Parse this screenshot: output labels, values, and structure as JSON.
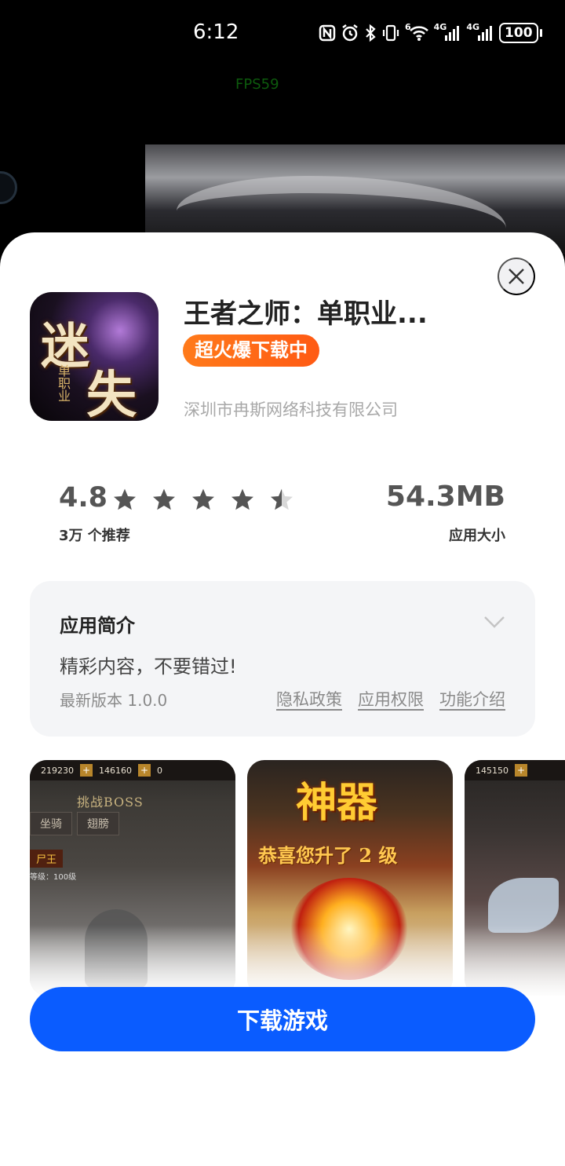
{
  "status_bar": {
    "time": "6:12",
    "net1": "4G",
    "net2": "4G",
    "wifi_tag": "6",
    "battery": "100"
  },
  "overlay": {
    "fps": "FPS59"
  },
  "app": {
    "title": "王者之师：单职业...",
    "badge": "超火爆下载中",
    "developer": "深圳市冉斯网络科技有限公司",
    "icon_text": [
      "迷",
      "失",
      "单职业"
    ]
  },
  "stats": {
    "rating": "4.8",
    "rating_value": 4.5,
    "rating_max": 5,
    "recommend_count": "3万 个推荐",
    "size": "54.3MB",
    "size_label": "应用大小"
  },
  "intro": {
    "title": "应用简介",
    "text": "精彩内容，不要错过!",
    "version": "最新版本 1.0.0",
    "links": [
      "隐私政策",
      "应用权限",
      "功能介绍"
    ]
  },
  "screenshots": {
    "shot1": {
      "gold": "219230",
      "yuanbao": "146160",
      "diamond": "0",
      "banner": "挑战BOSS",
      "tabs": [
        "坐骑",
        "翅膀"
      ],
      "boss": "尸王",
      "level": "等级：100级"
    },
    "shot2": {
      "title": "神器",
      "congrats": "恭喜您升了 2 级"
    },
    "shot3": {
      "gold": "145150"
    }
  },
  "actions": {
    "download": "下载游戏"
  },
  "colors": {
    "accent": "#0a5cff",
    "badge": "#ff6a18",
    "star": "#555555"
  }
}
